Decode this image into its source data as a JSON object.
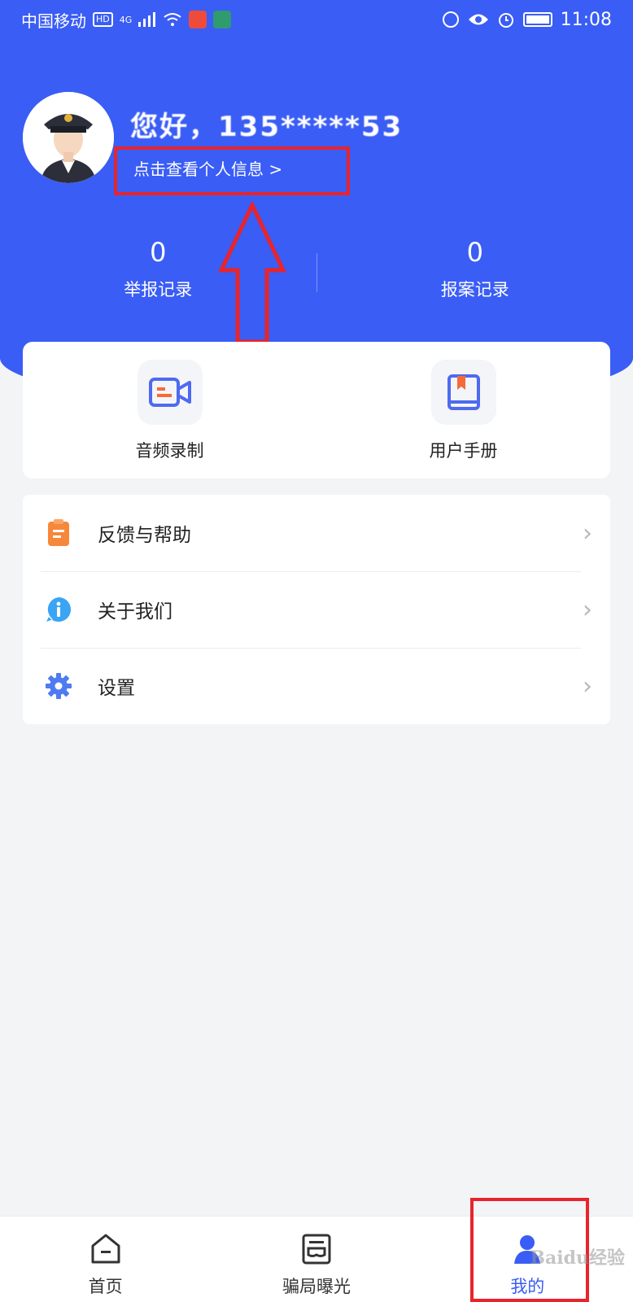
{
  "status_bar": {
    "carrier": "中国移动",
    "hd": "HD",
    "net": "4G",
    "time": "11:08"
  },
  "profile": {
    "greeting": "您好，135*****53",
    "info_link": "点击查看个人信息 >"
  },
  "stats": [
    {
      "value": "0",
      "label": "举报记录"
    },
    {
      "value": "0",
      "label": "报案记录"
    }
  ],
  "tools": [
    {
      "label": "音频录制",
      "icon": "video-record-icon"
    },
    {
      "label": "用户手册",
      "icon": "book-icon"
    }
  ],
  "menu": [
    {
      "label": "反馈与帮助",
      "icon": "clipboard-icon",
      "color": "#f7873a"
    },
    {
      "label": "关于我们",
      "icon": "info-icon",
      "color": "#3aa4f5"
    },
    {
      "label": "设置",
      "icon": "gear-icon",
      "color": "#4e7bf2"
    }
  ],
  "tabbar": [
    {
      "label": "首页",
      "icon": "home-icon",
      "active": false
    },
    {
      "label": "骗局曝光",
      "icon": "exposure-icon",
      "active": false
    },
    {
      "label": "我的",
      "icon": "user-icon",
      "active": true
    }
  ],
  "watermark": "Baidu经验",
  "colors": {
    "brand_blue": "#3a5df5",
    "highlight_red": "#e8242c",
    "chevron": "#b8b8b8"
  }
}
